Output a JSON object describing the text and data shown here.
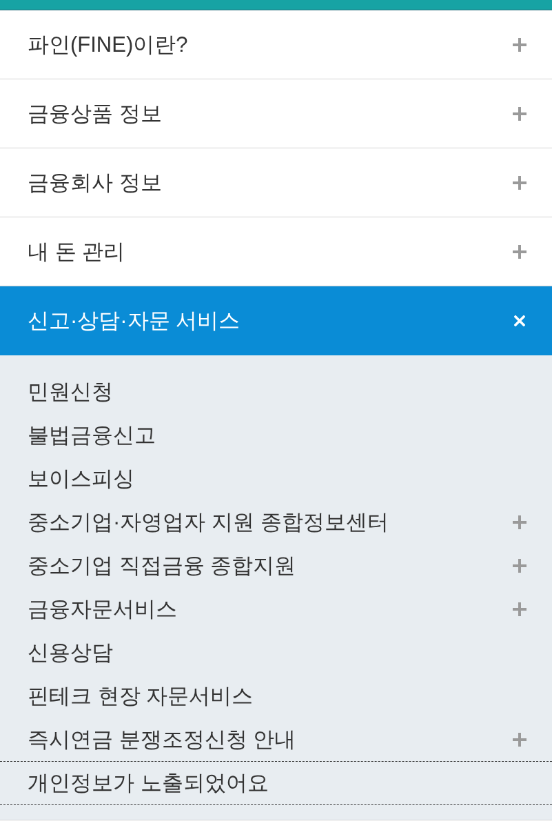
{
  "menu": [
    {
      "label": "파인(FINE)이란?",
      "expanded": false
    },
    {
      "label": "금융상품 정보",
      "expanded": false
    },
    {
      "label": "금융회사 정보",
      "expanded": false
    },
    {
      "label": "내 돈 관리",
      "expanded": false
    },
    {
      "label": "신고·상담·자문 서비스",
      "expanded": true,
      "children": [
        {
          "label": "민원신청",
          "expandable": false,
          "kind": "link"
        },
        {
          "label": "불법금융신고",
          "expandable": false,
          "kind": "link"
        },
        {
          "label": "보이스피싱",
          "expandable": false,
          "kind": "link"
        },
        {
          "label": "중소기업·자영업자 지원 종합정보센터",
          "expandable": true,
          "kind": "link"
        },
        {
          "label": "중소기업 직접금융 종합지원",
          "expandable": true,
          "kind": "link"
        },
        {
          "label": "금융자문서비스",
          "expandable": true,
          "kind": "link"
        },
        {
          "label": "신용상담",
          "expandable": false,
          "kind": "link"
        },
        {
          "label": "핀테크 현장 자문서비스",
          "expandable": false,
          "kind": "link"
        },
        {
          "label": "즉시연금 분쟁조정신청 안내",
          "expandable": true,
          "kind": "link"
        },
        {
          "label": "개인정보가 노출되었어요",
          "expandable": false,
          "kind": "notice"
        }
      ]
    }
  ]
}
